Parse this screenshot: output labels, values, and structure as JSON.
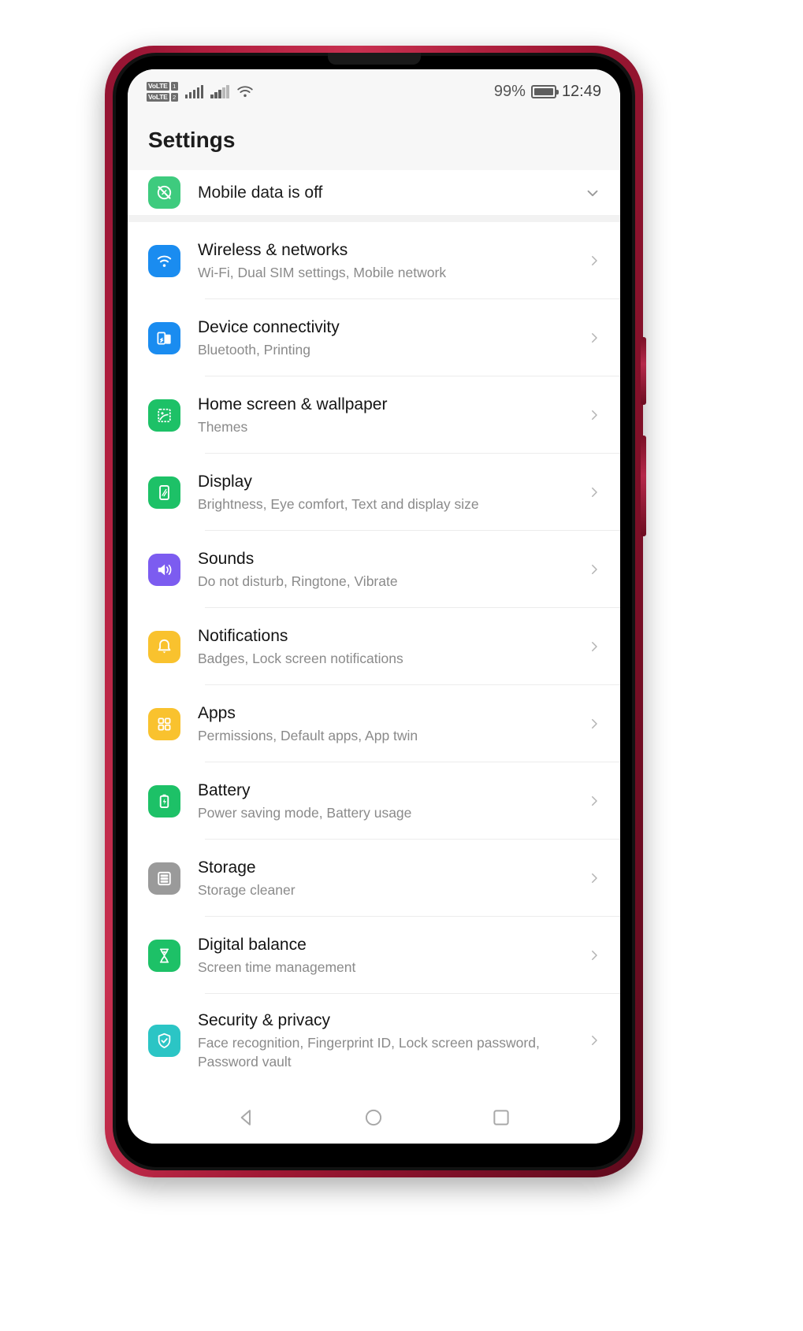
{
  "status_bar": {
    "volte_1_label": "VoLTE",
    "volte_1_sim": "1",
    "volte_2_label": "VoLTE",
    "volte_2_sim": "2",
    "signal_1": "signal-bars-icon",
    "signal_2": "signal-bars-icon",
    "wifi": "wifi-icon",
    "battery_percent": "99%",
    "battery_icon": "battery-icon",
    "time": "12:49"
  },
  "header": {
    "title": "Settings"
  },
  "pinned": {
    "label": "Mobile data is off",
    "icon": "mobile-data-off-icon",
    "icon_color": "#3ECB7E",
    "chevron": "chevron-down-icon"
  },
  "list": {
    "items": [
      {
        "title": "Wireless & networks",
        "subtitle": "Wi-Fi, Dual SIM settings, Mobile network",
        "icon": "wifi-icon",
        "color": "#1A8CF0",
        "arrow": "chevron-right-icon"
      },
      {
        "title": "Device connectivity",
        "subtitle": "Bluetooth, Printing",
        "icon": "device-connectivity-icon",
        "color": "#1A8CF0",
        "arrow": "chevron-right-icon"
      },
      {
        "title": "Home screen & wallpaper",
        "subtitle": "Themes",
        "icon": "wallpaper-image-icon",
        "color": "#1DC167",
        "arrow": "chevron-right-icon"
      },
      {
        "title": "Display",
        "subtitle": "Brightness, Eye comfort, Text and display size",
        "icon": "display-phone-icon",
        "color": "#1DC167",
        "arrow": "chevron-right-icon"
      },
      {
        "title": "Sounds",
        "subtitle": "Do not disturb, Ringtone, Vibrate",
        "icon": "speaker-volume-icon",
        "color": "#7C5CF0",
        "arrow": "chevron-right-icon"
      },
      {
        "title": "Notifications",
        "subtitle": "Badges, Lock screen notifications",
        "icon": "bell-icon",
        "color": "#F9C22E",
        "arrow": "chevron-right-icon"
      },
      {
        "title": "Apps",
        "subtitle": "Permissions, Default apps, App twin",
        "icon": "apps-grid-icon",
        "color": "#F9C22E",
        "arrow": "chevron-right-icon"
      },
      {
        "title": "Battery",
        "subtitle": "Power saving mode, Battery usage",
        "icon": "battery-bolt-icon",
        "color": "#1DC167",
        "arrow": "chevron-right-icon"
      },
      {
        "title": "Storage",
        "subtitle": "Storage cleaner",
        "icon": "storage-stack-icon",
        "color": "#9A9A9A",
        "arrow": "chevron-right-icon"
      },
      {
        "title": "Digital balance",
        "subtitle": "Screen time management",
        "icon": "hourglass-icon",
        "color": "#1DC167",
        "arrow": "chevron-right-icon"
      },
      {
        "title": "Security & privacy",
        "subtitle": "Face recognition, Fingerprint ID, Lock screen password, Password vault",
        "icon": "shield-check-icon",
        "color": "#2BC5C5",
        "arrow": "chevron-right-icon"
      }
    ]
  },
  "nav_bar": {
    "back": "back-triangle-icon",
    "home": "home-circle-icon",
    "recents": "recents-square-icon"
  }
}
